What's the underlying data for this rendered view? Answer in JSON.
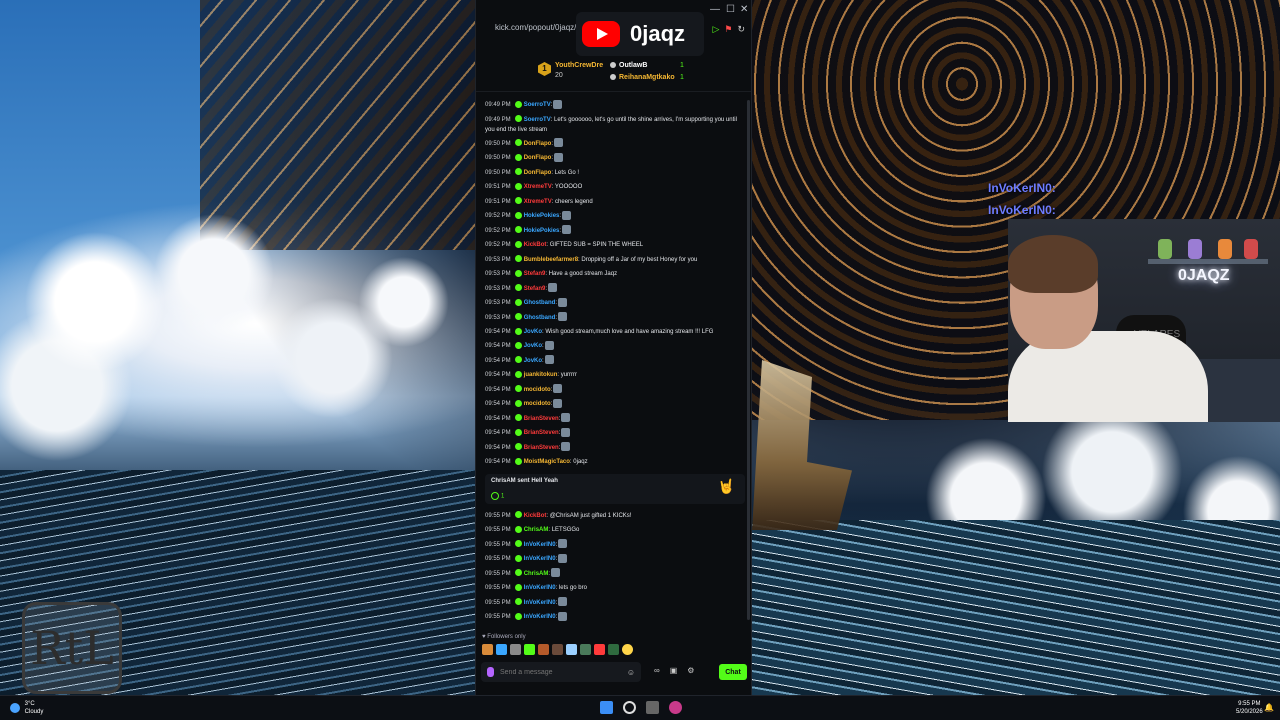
{
  "browser": {
    "url": "kick.com/popout/0jaqz/cl",
    "channel_name": "0jaqz"
  },
  "leaderboard": {
    "top": {
      "rank": "1",
      "name": "YouthCrewDre",
      "value": "20"
    },
    "items": [
      {
        "name": "OutlawB",
        "value": "1",
        "color": "#ffffff"
      },
      {
        "name": "ReihanaMgtkako",
        "value": "1",
        "color": "#f5b733"
      }
    ]
  },
  "messages": [
    {
      "time": "09:49 PM",
      "user": "SoerroTV",
      "color": "#3aa7ff",
      "text": ":"
    },
    {
      "time": "09:49 PM",
      "user": "SoerroTV",
      "color": "#3aa7ff",
      "text": ": Let's goooooo, let's go until the shine arrives, I'm supporting you until you end the live stream",
      "wrap": true
    },
    {
      "time": "09:50 PM",
      "user": "DonFlapo",
      "color": "#f5b733",
      "text": ":"
    },
    {
      "time": "09:50 PM",
      "user": "DonFlapo",
      "color": "#f5b733",
      "text": ":"
    },
    {
      "time": "09:50 PM",
      "user": "DonFlapo",
      "color": "#f5b733",
      "text": ": Lets Go !"
    },
    {
      "time": "09:51 PM",
      "user": "XtremeTV",
      "color": "#ff3b3b",
      "text": ": YOOOOO"
    },
    {
      "time": "09:51 PM",
      "user": "XtremeTV",
      "color": "#ff3b3b",
      "text": ": cheers legend"
    },
    {
      "time": "09:52 PM",
      "user": "HokiePokies",
      "color": "#3aa7ff",
      "text": ":"
    },
    {
      "time": "09:52 PM",
      "user": "HokiePokies",
      "color": "#3aa7ff",
      "text": ":"
    },
    {
      "time": "09:52 PM",
      "user": "KickBot",
      "color": "#ff3b3b",
      "text": ": GIFTED SUB = SPIN THE WHEEL"
    },
    {
      "time": "09:53 PM",
      "user": "Bumblebeefarmer8",
      "color": "#f5b733",
      "text": ": Dropping off a Jar of my best Honey for you"
    },
    {
      "time": "09:53 PM",
      "user": "Stefan9",
      "color": "#ff3b3b",
      "text": ": Have a good stream Jaqz"
    },
    {
      "time": "09:53 PM",
      "user": "Stefan9",
      "color": "#ff3b3b",
      "text": ":"
    },
    {
      "time": "09:53 PM",
      "user": "Ghostband",
      "color": "#3aa7ff",
      "text": ":"
    },
    {
      "time": "09:53 PM",
      "user": "Ghostband",
      "color": "#3aa7ff",
      "text": ":"
    },
    {
      "time": "09:54 PM",
      "user": "JovKo",
      "color": "#3aa7ff",
      "text": ": Wish good stream,much love and have amazing stream !!! LFG",
      "wrap": true
    },
    {
      "time": "09:54 PM",
      "user": "JovKo",
      "color": "#3aa7ff",
      "text": ":"
    },
    {
      "time": "09:54 PM",
      "user": "JovKo",
      "color": "#3aa7ff",
      "text": ":"
    },
    {
      "time": "09:54 PM",
      "user": "juankitokun",
      "color": "#f5b733",
      "text": ":  yurrrrr"
    },
    {
      "time": "09:54 PM",
      "user": "mocidoto",
      "color": "#f5b733",
      "text": ":"
    },
    {
      "time": "09:54 PM",
      "user": "mocidoto",
      "color": "#f5b733",
      "text": ":"
    },
    {
      "time": "09:54 PM",
      "user": "BrianSteven",
      "color": "#ff3b3b",
      "text": ":"
    },
    {
      "time": "09:54 PM",
      "user": "BrianSteven",
      "color": "#ff3b3b",
      "text": ":"
    },
    {
      "time": "09:54 PM",
      "user": "BrianSteven",
      "color": "#ff3b3b",
      "text": ":"
    },
    {
      "time": "09:54 PM",
      "user": "MoistMagicTaco",
      "color": "#f5b733",
      "text": ": 0jaqz"
    }
  ],
  "gift": {
    "text": "ChrisAM sent Hell Yeah",
    "count": "1"
  },
  "messages_after": [
    {
      "time": "09:55 PM",
      "user": "KickBot",
      "color": "#ff3b3b",
      "text": ": @ChrisAM just gifted 1 KICKs!"
    },
    {
      "time": "09:55 PM",
      "user": "ChrisAM",
      "color": "#53fc18",
      "text": ": LETSGGo"
    },
    {
      "time": "09:55 PM",
      "user": "InVoKerIN0",
      "color": "#3aa7ff",
      "text": ":"
    },
    {
      "time": "09:55 PM",
      "user": "InVoKerIN0",
      "color": "#3aa7ff",
      "text": ":"
    },
    {
      "time": "09:55 PM",
      "user": "ChrisAM",
      "color": "#53fc18",
      "text": ":"
    },
    {
      "time": "09:55 PM",
      "user": "InVoKerIN0",
      "color": "#3aa7ff",
      "text": ": lets go bro"
    },
    {
      "time": "09:55 PM",
      "user": "InVoKerIN0",
      "color": "#3aa7ff",
      "text": ":"
    },
    {
      "time": "09:55 PM",
      "user": "InVoKerIN0",
      "color": "#3aa7ff",
      "text": ":"
    }
  ],
  "chat_footer": {
    "followers_only": "Followers only",
    "placeholder": "Send a message",
    "chat_button": "Chat"
  },
  "overlay": {
    "line1": "InVoKerIN0:",
    "line2": "InVoKerIN0:",
    "neon": "0JAQZ",
    "chair_brand": "VELARES"
  },
  "desktop": {
    "logo": "RtL"
  },
  "taskbar": {
    "temp": "3°C",
    "weather": "Cloudy",
    "time": "9:55 PM",
    "date": "5/20/2026"
  }
}
